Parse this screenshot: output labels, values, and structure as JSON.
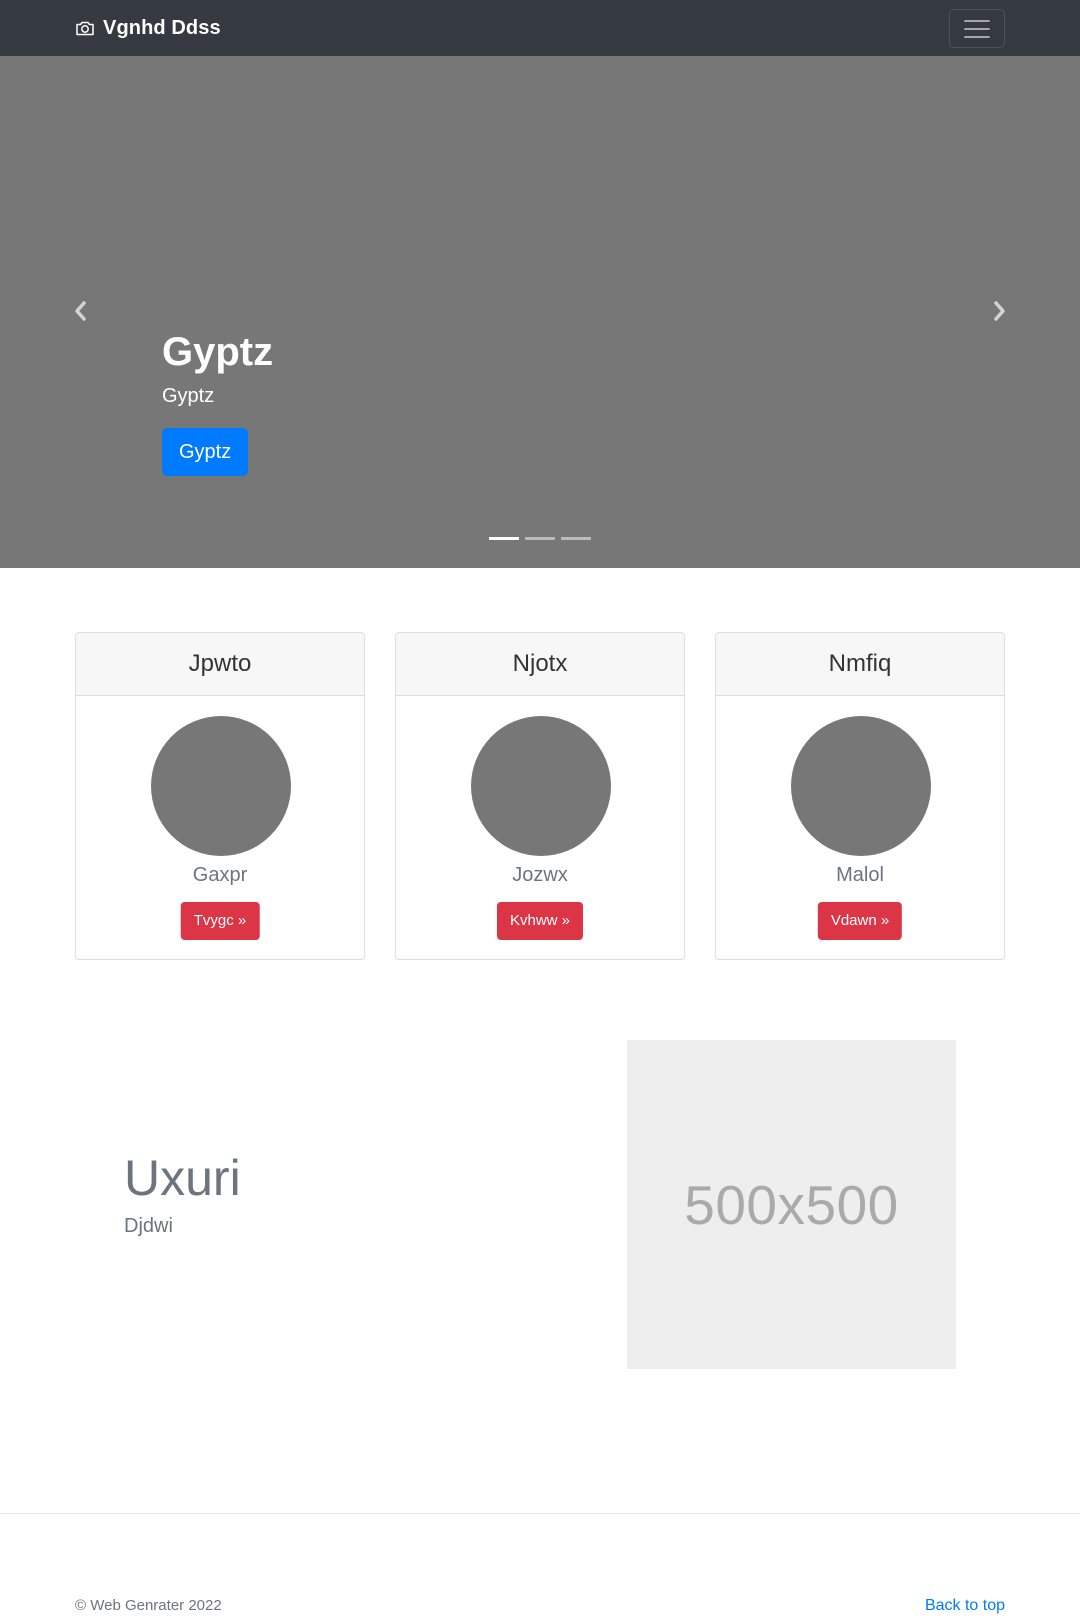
{
  "navbar": {
    "brand": "Vgnhd Ddss",
    "brand_icon": "camera-icon",
    "toggler_icon": "hamburger-menu-icon"
  },
  "carousel": {
    "heading": "Gyptz",
    "text": "Gyptz",
    "button_label": "Gyptz",
    "slide_count": 3,
    "active_slide": 1,
    "prev_icon": "chevron-left-icon",
    "next_icon": "chevron-right-icon"
  },
  "cards": [
    {
      "title": "Jpwto",
      "name": "Gaxpr",
      "button_label": "Tvygc »"
    },
    {
      "title": "Njotx",
      "name": "Jozwx",
      "button_label": "Kvhww »"
    },
    {
      "title": "Nmfiq",
      "name": "Malol",
      "button_label": "Vdawn »"
    }
  ],
  "feature": {
    "heading": "Uxuri",
    "subheading": "Djdwi",
    "image_placeholder": "500x500"
  },
  "footer": {
    "copyright": "© Web Genrater 2022",
    "back_to_top": "Back to top"
  },
  "colors": {
    "navbar_bg": "#343a40",
    "carousel_bg": "#777777",
    "primary": "#007bff",
    "danger": "#dc3545",
    "muted": "#6c757d"
  }
}
